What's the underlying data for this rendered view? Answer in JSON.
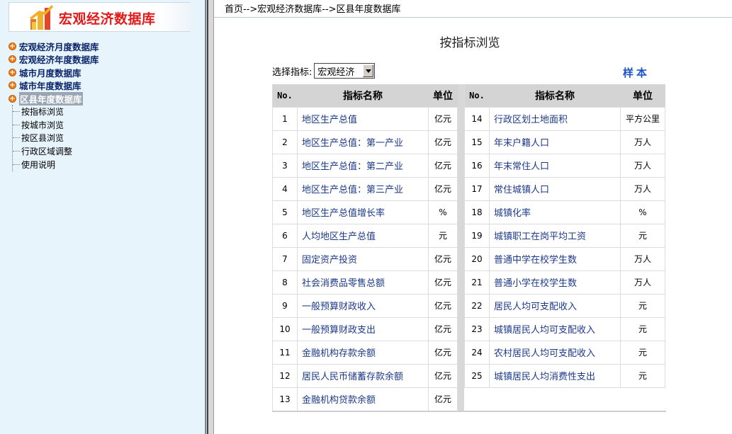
{
  "app": {
    "logo_title": "宏观经济数据库"
  },
  "nav": {
    "items": [
      {
        "label": "宏观经济月度数据库"
      },
      {
        "label": "宏观经济年度数据库"
      },
      {
        "label": "城市月度数据库"
      },
      {
        "label": "城市年度数据库"
      },
      {
        "label": "区县年度数据库"
      }
    ],
    "sub_items": [
      {
        "label": "按指标浏览"
      },
      {
        "label": "按城市浏览"
      },
      {
        "label": "按区县浏览"
      },
      {
        "label": "行政区域调整"
      },
      {
        "label": "使用说明"
      }
    ]
  },
  "breadcrumb": "首页-->宏观经济数据库-->区县年度数据库",
  "page_title": "按指标浏览",
  "selector": {
    "label": "选择指标:",
    "value": "宏观经济"
  },
  "sample_link": "样本",
  "table": {
    "headers": {
      "no": "No.",
      "name": "指标名称",
      "unit": "单位"
    },
    "left_rows": [
      {
        "no": "1",
        "name": "地区生产总值",
        "unit": "亿元"
      },
      {
        "no": "2",
        "name": "地区生产总值：第一产业",
        "unit": "亿元"
      },
      {
        "no": "3",
        "name": "地区生产总值：第二产业",
        "unit": "亿元"
      },
      {
        "no": "4",
        "name": "地区生产总值：第三产业",
        "unit": "亿元"
      },
      {
        "no": "5",
        "name": "地区生产总值增长率",
        "unit": "%"
      },
      {
        "no": "6",
        "name": "人均地区生产总值",
        "unit": "元"
      },
      {
        "no": "7",
        "name": "固定资产投资",
        "unit": "亿元"
      },
      {
        "no": "8",
        "name": "社会消费品零售总额",
        "unit": "亿元"
      },
      {
        "no": "9",
        "name": "一般预算财政收入",
        "unit": "亿元"
      },
      {
        "no": "10",
        "name": "一般预算财政支出",
        "unit": "亿元"
      },
      {
        "no": "11",
        "name": "金融机构存款余额",
        "unit": "亿元"
      },
      {
        "no": "12",
        "name": "居民人民币储蓄存款余额",
        "unit": "亿元"
      },
      {
        "no": "13",
        "name": "金融机构贷款余额",
        "unit": "亿元"
      }
    ],
    "right_rows": [
      {
        "no": "14",
        "name": "行政区划土地面积",
        "unit": "平方公里"
      },
      {
        "no": "15",
        "name": "年末户籍人口",
        "unit": "万人"
      },
      {
        "no": "16",
        "name": "年末常住人口",
        "unit": "万人"
      },
      {
        "no": "17",
        "name": "常住城镇人口",
        "unit": "万人"
      },
      {
        "no": "18",
        "name": "城镇化率",
        "unit": "%"
      },
      {
        "no": "19",
        "name": "城镇职工在岗平均工资",
        "unit": "元"
      },
      {
        "no": "20",
        "name": "普通中学在校学生数",
        "unit": "万人"
      },
      {
        "no": "21",
        "name": "普通小学在校学生数",
        "unit": "万人"
      },
      {
        "no": "22",
        "name": "居民人均可支配收入",
        "unit": "元"
      },
      {
        "no": "23",
        "name": "城镇居民人均可支配收入",
        "unit": "元"
      },
      {
        "no": "24",
        "name": "农村居民人均可支配收入",
        "unit": "元"
      },
      {
        "no": "25",
        "name": "城镇居民人均消费性支出",
        "unit": "元"
      }
    ]
  },
  "colors": {
    "logo_red": "#e21a1a",
    "nav_text": "#0a246a",
    "link_blue": "#1c3a8a",
    "sample_blue": "#1a55c9",
    "sidebar_bg": "#e8f4fc"
  }
}
